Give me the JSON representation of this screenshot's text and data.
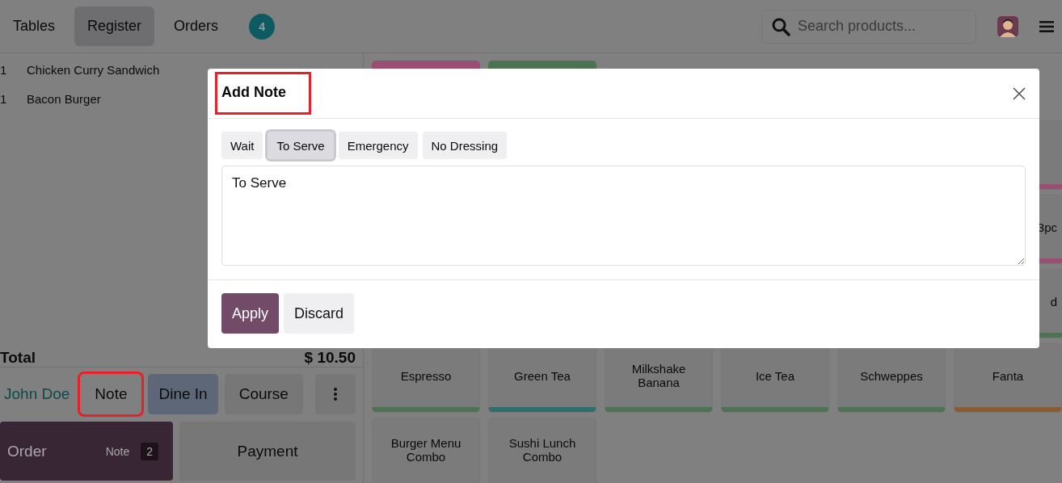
{
  "header": {
    "tabs": [
      {
        "label": "Tables",
        "selected": false
      },
      {
        "label": "Register",
        "selected": true
      },
      {
        "label": "Orders",
        "selected": false
      }
    ],
    "orders_badge": "4",
    "search": {
      "placeholder": "Search products..."
    }
  },
  "order_lines": [
    {
      "qty": "1",
      "name": "Chicken Curry Sandwich"
    },
    {
      "qty": "1",
      "name": "Bacon Burger"
    }
  ],
  "total": {
    "label": "Total",
    "amount": "$ 10.50"
  },
  "actions": [
    {
      "kind": "link",
      "label": "John Doe"
    },
    {
      "kind": "plain",
      "label": "Note",
      "highlighted": true
    },
    {
      "kind": "accent",
      "label": "Dine In"
    },
    {
      "kind": "plain",
      "label": "Course"
    },
    {
      "kind": "more"
    }
  ],
  "order_button": {
    "label": "Order",
    "note": "Note",
    "count": "2"
  },
  "payment_button": {
    "label": "Payment"
  },
  "categories": [
    {
      "color": "#9a4f72"
    },
    {
      "color": "#4e7352"
    }
  ],
  "product_rows": [
    [
      {
        "kind": "cut",
        "color": "#9a4f72"
      }
    ],
    [
      {
        "kind": "cut",
        "label": "3pc",
        "color": "#9a4f72"
      }
    ],
    [
      {
        "kind": "cut",
        "label": "d",
        "color": "#4e7352"
      }
    ],
    [
      {
        "kind": "product",
        "label": "Espresso",
        "color": "#4e7352"
      },
      {
        "kind": "product",
        "label": "Green Tea",
        "color": "#2f6e6d"
      },
      {
        "kind": "product",
        "label": "Milkshake Banana",
        "color": "#4e7352"
      },
      {
        "kind": "product",
        "label": "Ice Tea",
        "color": "#4e7352"
      },
      {
        "kind": "product",
        "label": "Schweppes",
        "color": "#4e7352"
      },
      {
        "kind": "product",
        "label": "Fanta",
        "color": "#8a5c36"
      }
    ],
    [
      {
        "kind": "product",
        "label": "Burger Menu Combo"
      },
      {
        "kind": "product",
        "label": "Sushi Lunch Combo"
      }
    ]
  ],
  "modal": {
    "title": "Add Note",
    "title_highlighted": true,
    "chips": [
      {
        "label": "Wait",
        "selected": false
      },
      {
        "label": "To Serve",
        "selected": true
      },
      {
        "label": "Emergency",
        "selected": false
      },
      {
        "label": "No Dressing",
        "selected": false
      }
    ],
    "note_value": "To Serve",
    "buttons": [
      {
        "kind": "primary",
        "label": "Apply"
      },
      {
        "kind": "secondary",
        "label": "Discard"
      }
    ]
  }
}
